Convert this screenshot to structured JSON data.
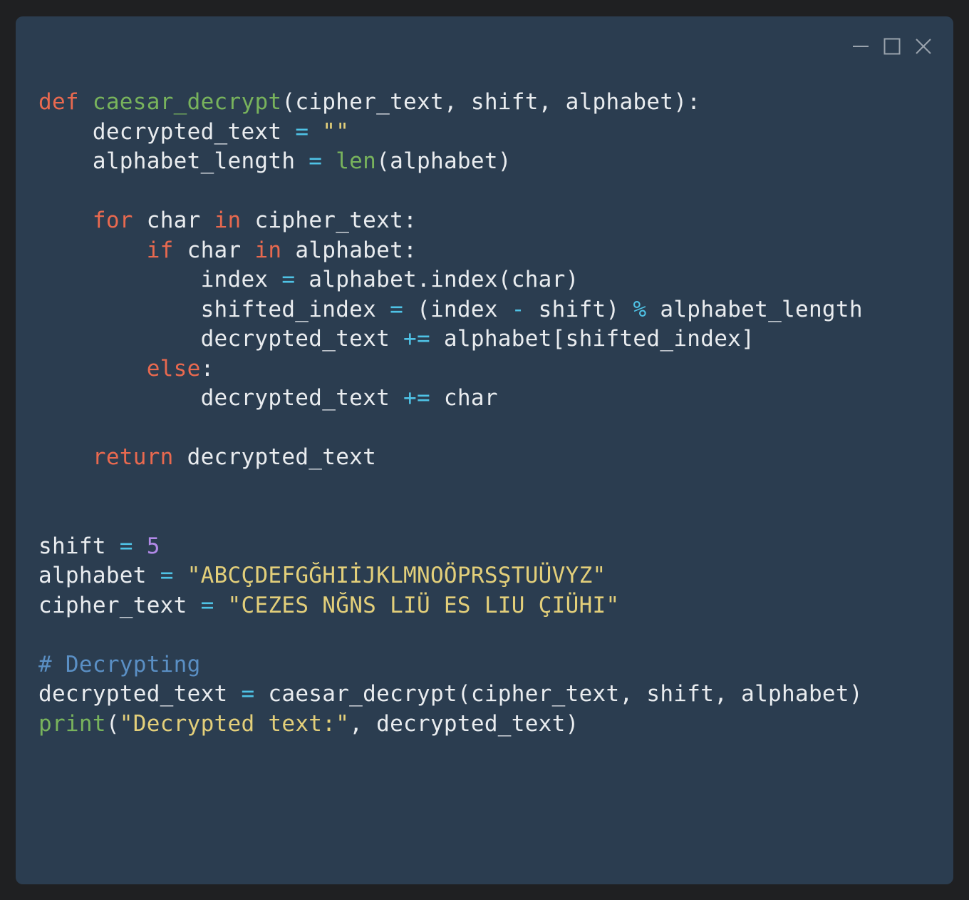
{
  "colors": {
    "background": "#2b3d50",
    "keyword": "#e8694f",
    "function": "#78b35c",
    "operator": "#4fc3e6",
    "string": "#e3cf7a",
    "number": "#b28ae8",
    "comment": "#5a8fc4",
    "identifier": "#e9ecef",
    "window_controls": "#9aa3ad"
  },
  "window_controls": [
    "minimize-icon",
    "maximize-icon",
    "close-icon"
  ],
  "code": {
    "lines": [
      [
        {
          "t": "kw",
          "v": "def"
        },
        {
          "t": "id",
          "v": " "
        },
        {
          "t": "fn",
          "v": "caesar_decrypt"
        },
        {
          "t": "id",
          "v": "(cipher_text, shift, alphabet):"
        }
      ],
      [
        {
          "t": "id",
          "v": "    decrypted_text "
        },
        {
          "t": "op",
          "v": "="
        },
        {
          "t": "id",
          "v": " "
        },
        {
          "t": "str",
          "v": "\"\""
        }
      ],
      [
        {
          "t": "id",
          "v": "    alphabet_length "
        },
        {
          "t": "op",
          "v": "="
        },
        {
          "t": "id",
          "v": " "
        },
        {
          "t": "fn",
          "v": "len"
        },
        {
          "t": "id",
          "v": "(alphabet)"
        }
      ],
      [],
      [
        {
          "t": "id",
          "v": "    "
        },
        {
          "t": "kw",
          "v": "for"
        },
        {
          "t": "id",
          "v": " char "
        },
        {
          "t": "kw",
          "v": "in"
        },
        {
          "t": "id",
          "v": " cipher_text:"
        }
      ],
      [
        {
          "t": "id",
          "v": "        "
        },
        {
          "t": "kw",
          "v": "if"
        },
        {
          "t": "id",
          "v": " char "
        },
        {
          "t": "kw",
          "v": "in"
        },
        {
          "t": "id",
          "v": " alphabet:"
        }
      ],
      [
        {
          "t": "id",
          "v": "            index "
        },
        {
          "t": "op",
          "v": "="
        },
        {
          "t": "id",
          "v": " alphabet.index(char)"
        }
      ],
      [
        {
          "t": "id",
          "v": "            shifted_index "
        },
        {
          "t": "op",
          "v": "="
        },
        {
          "t": "id",
          "v": " (index "
        },
        {
          "t": "op",
          "v": "-"
        },
        {
          "t": "id",
          "v": " shift) "
        },
        {
          "t": "op",
          "v": "%"
        },
        {
          "t": "id",
          "v": " alphabet_length"
        }
      ],
      [
        {
          "t": "id",
          "v": "            decrypted_text "
        },
        {
          "t": "op",
          "v": "+="
        },
        {
          "t": "id",
          "v": " alphabet[shifted_index]"
        }
      ],
      [
        {
          "t": "id",
          "v": "        "
        },
        {
          "t": "kw",
          "v": "else"
        },
        {
          "t": "id",
          "v": ":"
        }
      ],
      [
        {
          "t": "id",
          "v": "            decrypted_text "
        },
        {
          "t": "op",
          "v": "+="
        },
        {
          "t": "id",
          "v": " char"
        }
      ],
      [],
      [
        {
          "t": "id",
          "v": "    "
        },
        {
          "t": "kw",
          "v": "return"
        },
        {
          "t": "id",
          "v": " decrypted_text"
        }
      ],
      [],
      [],
      [
        {
          "t": "id",
          "v": "shift "
        },
        {
          "t": "op",
          "v": "="
        },
        {
          "t": "id",
          "v": " "
        },
        {
          "t": "num",
          "v": "5"
        }
      ],
      [
        {
          "t": "id",
          "v": "alphabet "
        },
        {
          "t": "op",
          "v": "="
        },
        {
          "t": "id",
          "v": " "
        },
        {
          "t": "str",
          "v": "\"ABCÇDEFGĞHIİJKLMNOÖPRSŞTUÜVYZ\""
        }
      ],
      [
        {
          "t": "id",
          "v": "cipher_text "
        },
        {
          "t": "op",
          "v": "="
        },
        {
          "t": "id",
          "v": " "
        },
        {
          "t": "str",
          "v": "\"CEZES NĞNS LIÜ ES LIU ÇIÜHI\""
        }
      ],
      [],
      [
        {
          "t": "com",
          "v": "# Decrypting"
        }
      ],
      [
        {
          "t": "id",
          "v": "decrypted_text "
        },
        {
          "t": "op",
          "v": "="
        },
        {
          "t": "id",
          "v": " caesar_decrypt(cipher_text, shift, alphabet)"
        }
      ],
      [
        {
          "t": "fn",
          "v": "print"
        },
        {
          "t": "id",
          "v": "("
        },
        {
          "t": "str",
          "v": "\"Decrypted text:\""
        },
        {
          "t": "id",
          "v": ", decrypted_text)"
        }
      ]
    ]
  }
}
